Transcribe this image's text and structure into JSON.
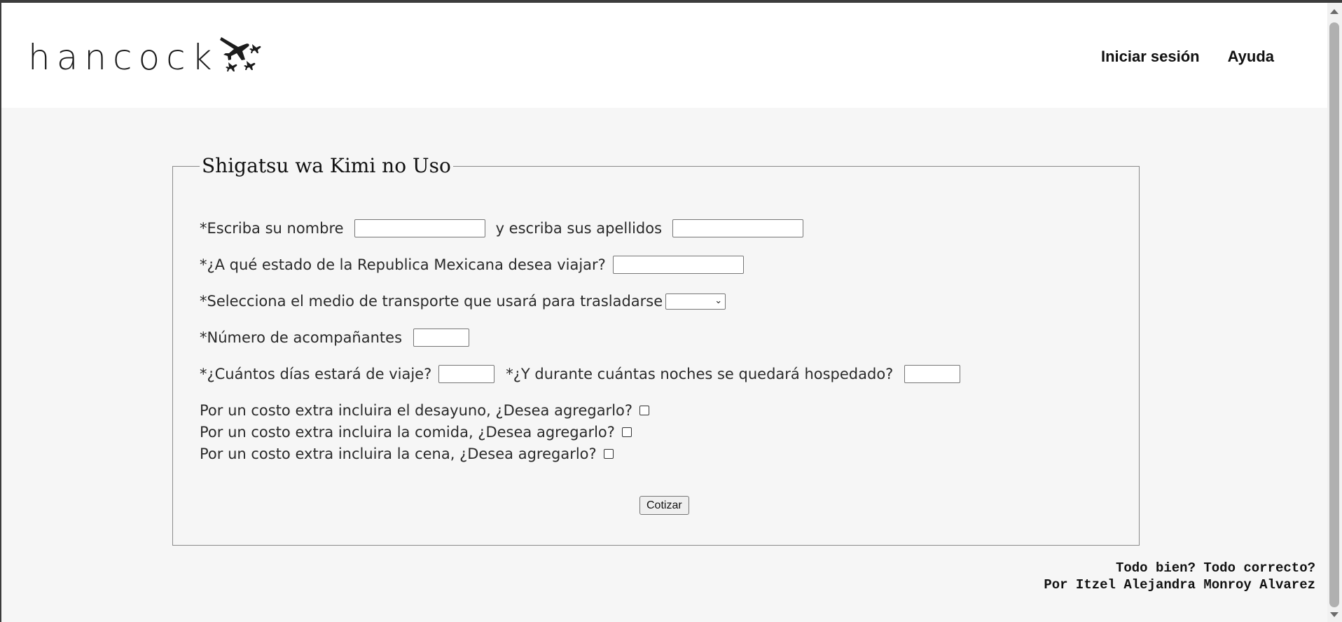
{
  "header": {
    "logo_text": "hancock",
    "logo_icon": "airplanes-icon",
    "nav": [
      {
        "label": "Iniciar sesión"
      },
      {
        "label": "Ayuda"
      }
    ]
  },
  "form": {
    "legend": "Shigatsu wa Kimi no Uso",
    "name_label": "*Escriba su nombre",
    "name_value": "",
    "surname_label": "y escriba sus apellidos",
    "surname_value": "",
    "state_label": "*¿A qué estado de la Republica Mexicana desea viajar?",
    "state_value": "",
    "transport_label": "*Selecciona el medio de transporte que usará para trasladarse",
    "transport_value": "",
    "companions_label": "*Número de acompañantes",
    "companions_value": "",
    "days_label": "*¿Cuántos días estará de viaje?",
    "days_value": "",
    "nights_label": "*¿Y durante cuántas noches se quedará hospedado?",
    "nights_value": "",
    "breakfast_label": "Por un costo extra incluira el desayuno, ¿Desea agregarlo?",
    "lunch_label": "Por un costo extra incluira la comida, ¿Desea agregarlo?",
    "dinner_label": "Por un costo extra incluira la cena, ¿Desea agregarlo?",
    "submit_label": "Cotizar"
  },
  "footer": {
    "line1": "Todo bien? Todo correcto?",
    "line2": "Por Itzel Alejandra Monroy Alvarez"
  }
}
